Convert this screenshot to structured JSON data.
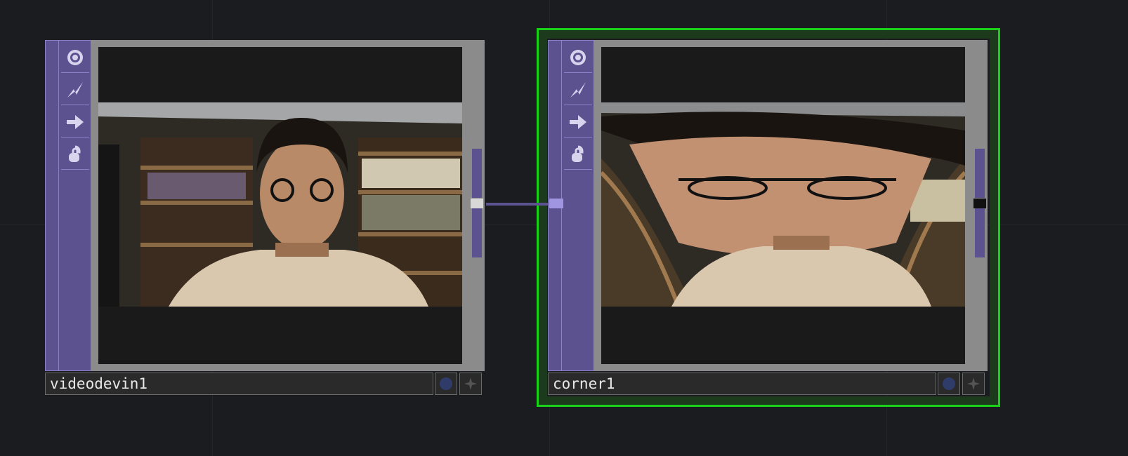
{
  "nodes": [
    {
      "name": "videodevin1",
      "icons": [
        "viewer-icon",
        "bypass-icon",
        "cook-icon",
        "lock-icon"
      ],
      "selected": false
    },
    {
      "name": "corner1",
      "icons": [
        "viewer-icon",
        "bypass-icon",
        "cook-icon",
        "lock-icon"
      ],
      "selected": true
    }
  ],
  "colors": {
    "node_bg": "#5d5290",
    "node_border": "#8c80c8",
    "selection": "#19d119",
    "canvas": "#1b1c20"
  }
}
